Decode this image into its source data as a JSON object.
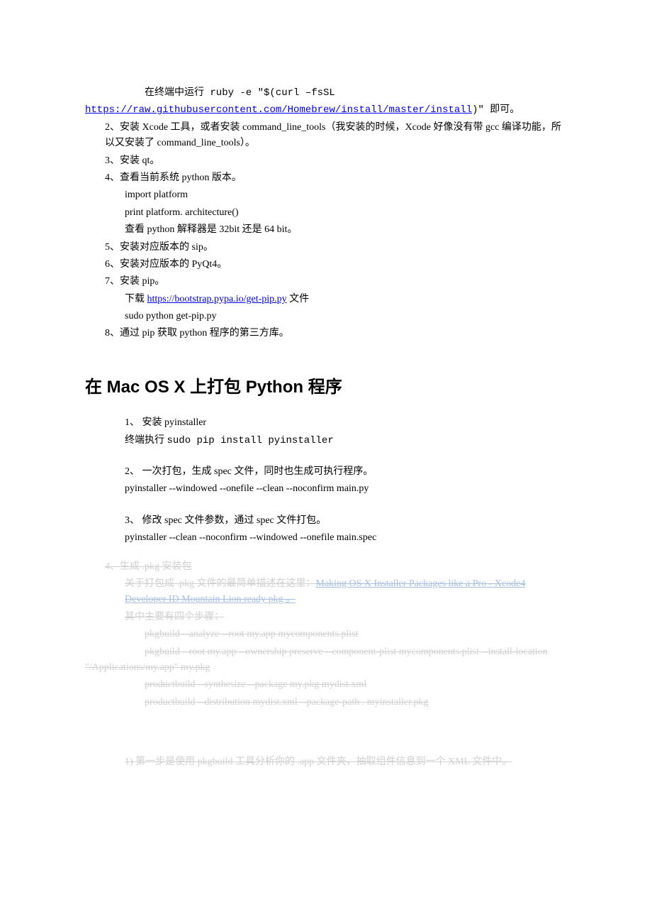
{
  "section1": {
    "line1_prefix": "在终端中运行 ruby -e \"$(curl  –fsSL ",
    "line1_link": "https://raw.githubusercontent.com/Homebrew/install/master/install",
    "line1_suffix": ")\"   即可。",
    "line2": "2、安装 Xcode 工具，或者安装 command_line_tools（我安装的时候，Xcode 好像没有带 gcc 编译功能，所以又安装了 command_line_tools）。",
    "line3": "3、安装 qt。",
    "line4": "4、查看当前系统 python 版本。",
    "line4a": "import platform",
    "line4b": "print platform. architecture()",
    "line4c": "查看 python 解释器是 32bit 还是 64 bit。",
    "line5": "5、安装对应版本的 sip。",
    "line6": "6、安装对应版本的 PyQt4。",
    "line7": "7、安装 pip。",
    "line7a_prefix": "下载  ",
    "line7a_link": "https://bootstrap.pypa.io/get-pip.py",
    "line7a_suffix": "  文件",
    "line7b": "sudo python get-pip.py",
    "line8": "8、通过 pip 获取 python 程序的第三方库。"
  },
  "heading": "在 Mac OS X 上打包 Python 程序",
  "section2": {
    "item1": "1、 安装 pyinstaller",
    "item1a_prefix": "终端执行   ",
    "item1a_cmd": "sudo pip install pyinstaller",
    "item2": "2、 一次打包，生成 spec 文件，同时也生成可执行程序。",
    "item2a": "pyinstaller --windowed --onefile --clean --noconfirm main.py",
    "item3": "3、 修改 spec 文件参数，通过 spec 文件打包。",
    "item3a": "pyinstaller --clean --noconfirm --windowed --onefile main.spec"
  },
  "struck": {
    "s4": "4、生成 .pkg  安装包",
    "s4a_prefix": "关于打包成 ",
    "s4a_mid": ".pkg",
    "s4a_mid2": " 文件的最简单描述在这里：",
    "s4a_link": "Making OS X Installer Packages like a Pro - Xcode4 Developer ID Mountain Lion ready pkg 。",
    "s4b": "其中主要有四个步骤：",
    "s4c": "pkgbuild --analyze --root my.app mycomponents.plist",
    "s4d": "pkgbuild  --root  my.app  --ownership  preserve  --component-plist  mycomponents.plist --install-location \"/Applications/my.app\" my.pkg",
    "s4e": "productbuild --synthesize --package my.pkg mydist.xml",
    "s4f": "productbuild --distribution mydist.xml --package-path . myinstaller.pkg",
    "s1": "1)  第一步是使用 ",
    "s1_mid": "pkgbuild",
    "s1_mid2": " 工具分析你的 ",
    "s1_mid3": ".app",
    "s1_suffix": " 文件夹，抽取组件信息到一个 XML  文件中。"
  }
}
